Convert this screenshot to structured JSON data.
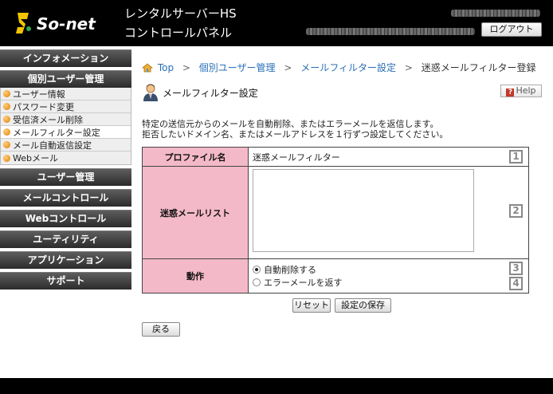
{
  "header": {
    "logo_text": "So-net",
    "title_line1": "レンタルサーバーHS",
    "title_line2": "コントロールパネル",
    "logout_label": "ログアウト"
  },
  "sidebar": {
    "items": [
      {
        "label": "インフォメーション"
      },
      {
        "label": "個別ユーザー管理"
      },
      {
        "label": "ユーザー管理"
      },
      {
        "label": "メールコントロール"
      },
      {
        "label": "Webコントロール"
      },
      {
        "label": "ユーティリティ"
      },
      {
        "label": "アプリケーション"
      },
      {
        "label": "サポート"
      }
    ],
    "sub_items": [
      {
        "label": "ユーザー情報"
      },
      {
        "label": "パスワード変更"
      },
      {
        "label": "受信済メール削除"
      },
      {
        "label": "メールフィルター設定"
      },
      {
        "label": "メール自動返信設定"
      },
      {
        "label": "Webメール"
      }
    ]
  },
  "breadcrumb": {
    "items": [
      "Top",
      "個別ユーザー管理",
      "メールフィルター設定",
      "迷惑メールフィルター登録"
    ],
    "separator": ">"
  },
  "page": {
    "title": "メールフィルター設定",
    "help_label": "Help",
    "description_line1": "特定の送信元からのメールを自動削除、またはエラーメールを返信します。",
    "description_line2": "拒否したいドメイン名、またはメールアドレスを１行ずつ設定してください。"
  },
  "form": {
    "profile_label": "プロファイル名",
    "profile_value": "迷惑メールフィルター",
    "list_label": "迷惑メールリスト",
    "list_value": "",
    "action_label": "動作",
    "action_options": [
      "自動削除する",
      "エラーメールを返す"
    ],
    "action_selected": "自動削除する",
    "markers": [
      "1",
      "2",
      "3",
      "4"
    ]
  },
  "buttons": {
    "reset": "リセット",
    "save": "設定の保存",
    "back": "戻る"
  },
  "colors": {
    "header_bg": "#000000",
    "label_cell_bg": "#f4b9c9",
    "link": "#2a6fb8",
    "logo_accent": "#f5c400"
  }
}
